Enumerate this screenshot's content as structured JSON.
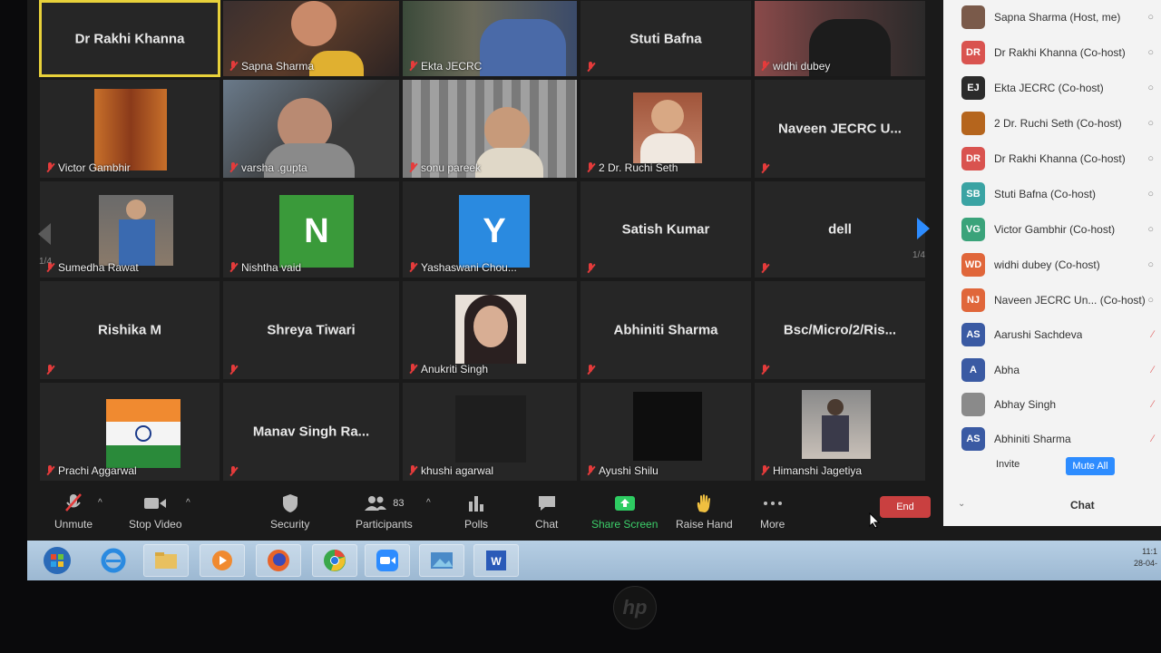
{
  "gallery": {
    "page_left": "1/4",
    "page_right": "1/4",
    "tiles": [
      {
        "name": "Dr Rakhi Khanna"
      },
      {
        "name": "Sapna Sharma"
      },
      {
        "name": "Ekta JECRC"
      },
      {
        "name": "Stuti Bafna"
      },
      {
        "name": "widhi dubey"
      },
      {
        "name": "Victor Gambhir"
      },
      {
        "name": "varsha .gupta"
      },
      {
        "name": "sonu pareek"
      },
      {
        "name": "2 Dr. Ruchi Seth"
      },
      {
        "name": "Naveen JECRC U..."
      },
      {
        "name": "Sumedha Rawat"
      },
      {
        "name": "Nishtha vaid",
        "initial": "N"
      },
      {
        "name": "Yashaswani Chou...",
        "initial": "Y"
      },
      {
        "name": "Satish Kumar"
      },
      {
        "name": "dell"
      },
      {
        "name": "Rishika M"
      },
      {
        "name": "Shreya Tiwari"
      },
      {
        "name": "Anukriti Singh"
      },
      {
        "name": "Abhiniti Sharma"
      },
      {
        "name": "Bsc/Micro/2/Ris..."
      },
      {
        "name": "Prachi Aggarwal"
      },
      {
        "name": "Manav Singh Ra..."
      },
      {
        "name": "khushi agarwal"
      },
      {
        "name": "Ayushi Shilu"
      },
      {
        "name": "Himanshi Jagetiya"
      }
    ]
  },
  "toolbar": {
    "unmute": "Unmute",
    "stop_video": "Stop Video",
    "security": "Security",
    "participants": "Participants",
    "participants_count": "83",
    "polls": "Polls",
    "chat": "Chat",
    "share_screen": "Share Screen",
    "raise_hand": "Raise Hand",
    "more": "More",
    "end": "End"
  },
  "panel": {
    "participants": [
      {
        "initials": "",
        "name": "Sapna Sharma (Host, me)",
        "color": "#7a5a4a"
      },
      {
        "initials": "DR",
        "name": "Dr Rakhi Khanna (Co-host)",
        "color": "#d9534f"
      },
      {
        "initials": "EJ",
        "name": "Ekta JECRC (Co-host)",
        "color": "#2b2b2b"
      },
      {
        "initials": "",
        "name": "2 Dr. Ruchi Seth (Co-host)",
        "color": "#b5651d"
      },
      {
        "initials": "DR",
        "name": "Dr Rakhi Khanna (Co-host)",
        "color": "#d9534f"
      },
      {
        "initials": "SB",
        "name": "Stuti Bafna (Co-host)",
        "color": "#3aa3a3"
      },
      {
        "initials": "VG",
        "name": "Victor Gambhir (Co-host)",
        "color": "#3aa37a"
      },
      {
        "initials": "WD",
        "name": "widhi dubey (Co-host)",
        "color": "#e0663a"
      },
      {
        "initials": "NJ",
        "name": "Naveen JECRC Un... (Co-host)",
        "color": "#e0663a"
      },
      {
        "initials": "AS",
        "name": "Aarushi Sachdeva",
        "color": "#3a5aa3"
      },
      {
        "initials": "A",
        "name": "Abha",
        "color": "#3a5aa3"
      },
      {
        "initials": "",
        "name": "Abhay Singh",
        "color": "#8a8a8a"
      },
      {
        "initials": "AS",
        "name": "Abhiniti Sharma",
        "color": "#3a5aa3"
      }
    ],
    "invite": "Invite",
    "mute_all": "Mute All",
    "chat": "Chat"
  },
  "tray": {
    "time": "11:1",
    "date": "28-04-"
  },
  "bezel": {
    "logo": "hp"
  }
}
